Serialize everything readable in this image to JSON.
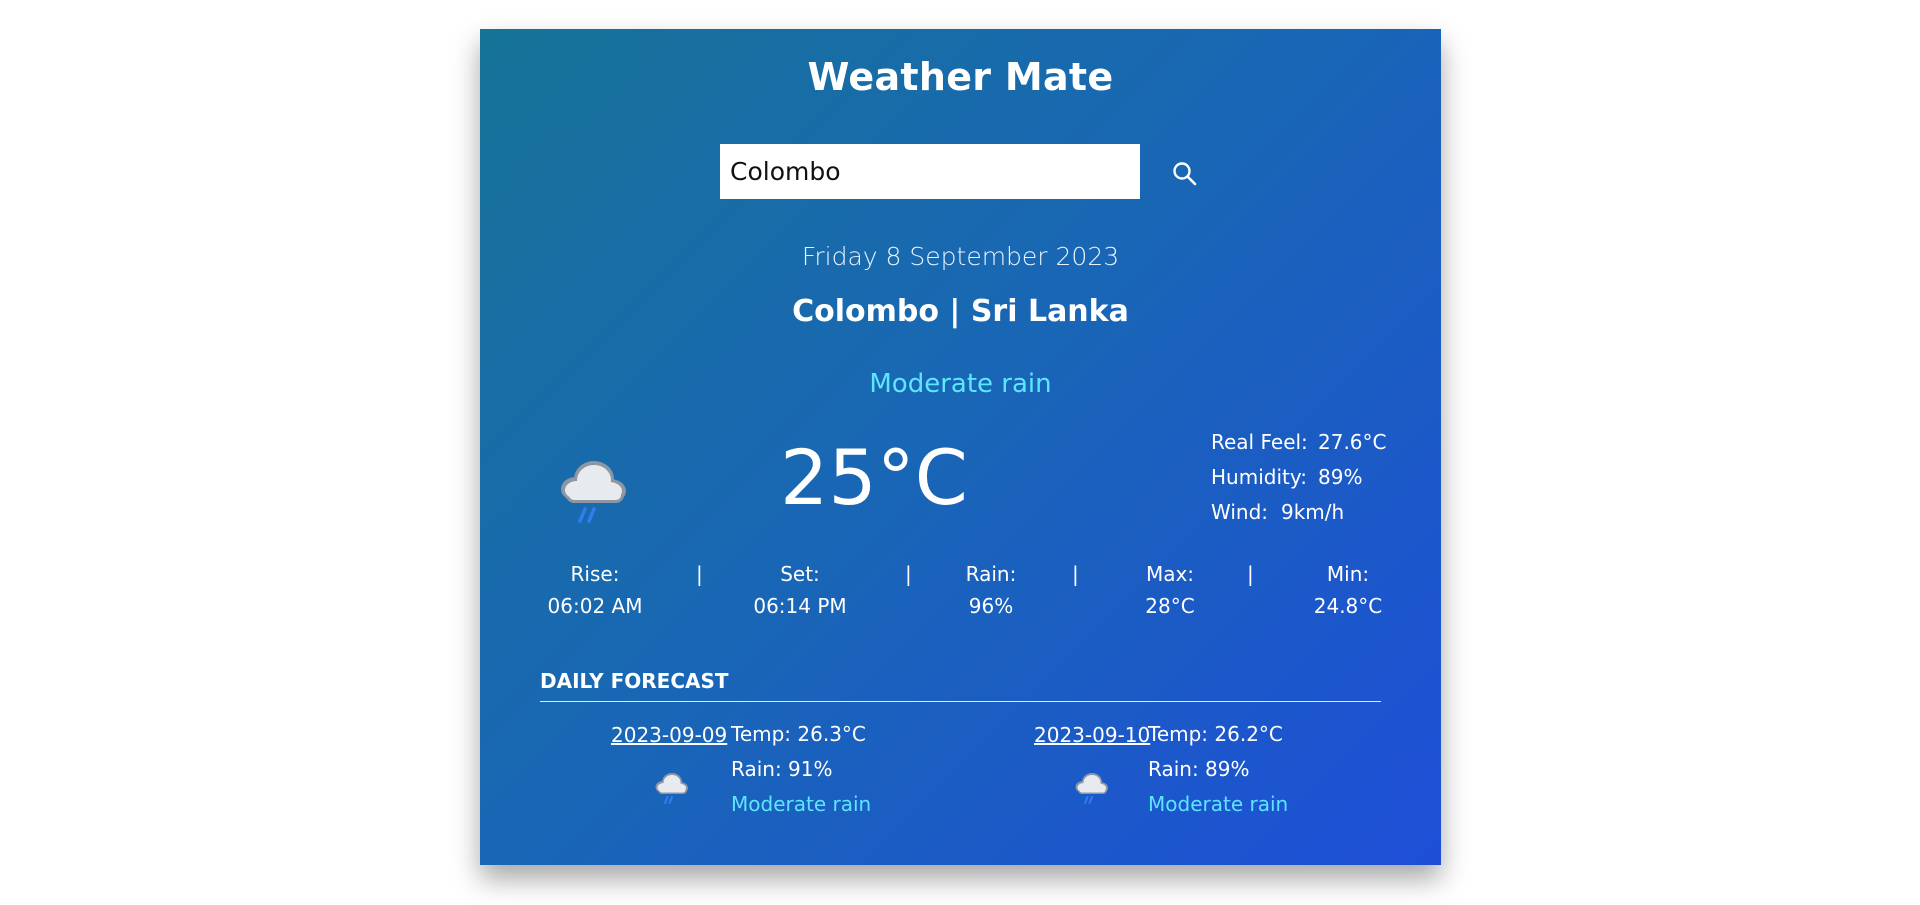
{
  "app": {
    "title": "Weather Mate"
  },
  "search": {
    "value": "Colombo"
  },
  "current": {
    "date": "Friday 8 September 2023",
    "location": "Colombo | Sri Lanka",
    "condition": "Moderate rain",
    "temperature": "25°C",
    "icon": "rain-cloud-icon",
    "details": [
      {
        "label": "Real Feel:",
        "value": "27.6°C"
      },
      {
        "label": "Humidity:",
        "value": "89%"
      },
      {
        "label": "Wind:",
        "value": "9km/h"
      }
    ],
    "stats": {
      "rise_label": "Rise:",
      "rise_value": "06:02 AM",
      "set_label": "Set:",
      "set_value": "06:14 PM",
      "rain_label": "Rain:",
      "rain_value": "96%",
      "max_label": "Max:",
      "max_value": "28°C",
      "min_label": "Min:",
      "min_value": "24.8°C",
      "separator": "|"
    }
  },
  "forecast": {
    "heading": "DAILY FORECAST",
    "days": [
      {
        "date": "2023-09-09",
        "temp": "Temp: 26.3°C",
        "rain": "Rain: 91%",
        "condition": "Moderate rain"
      },
      {
        "date": "2023-09-10",
        "temp": "Temp: 26.2°C",
        "rain": "Rain: 89%",
        "condition": "Moderate rain"
      }
    ]
  },
  "colors": {
    "gradient_start": "#167397",
    "gradient_end": "#1e4ed8",
    "accent": "#5ee5ff"
  }
}
